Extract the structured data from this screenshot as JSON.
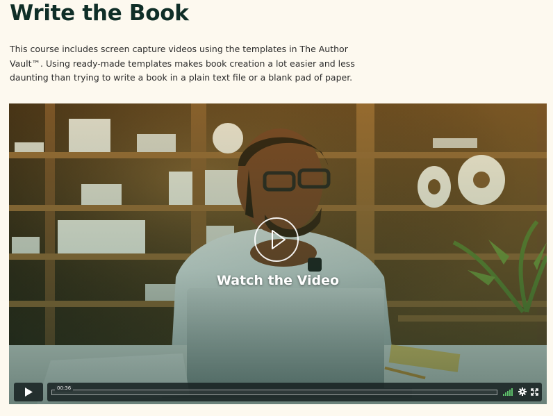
{
  "page": {
    "title": "Write the Book",
    "intro": "This course includes screen capture videos using the templates in The Author Vault™. Using ready-made templates makes book creation a lot easier and less daunting than trying to write a book in a plain text file or a blank pad of paper."
  },
  "video": {
    "overlay_label": "Watch the Video",
    "current_time": "00:36",
    "progress": 0,
    "accent_color": "#6fb4a6"
  },
  "icons": {
    "play_overlay": "play-circle-icon",
    "play_control": "play-icon",
    "volume": "volume-bars-icon",
    "settings": "gear-icon",
    "fullscreen": "fullscreen-icon"
  }
}
